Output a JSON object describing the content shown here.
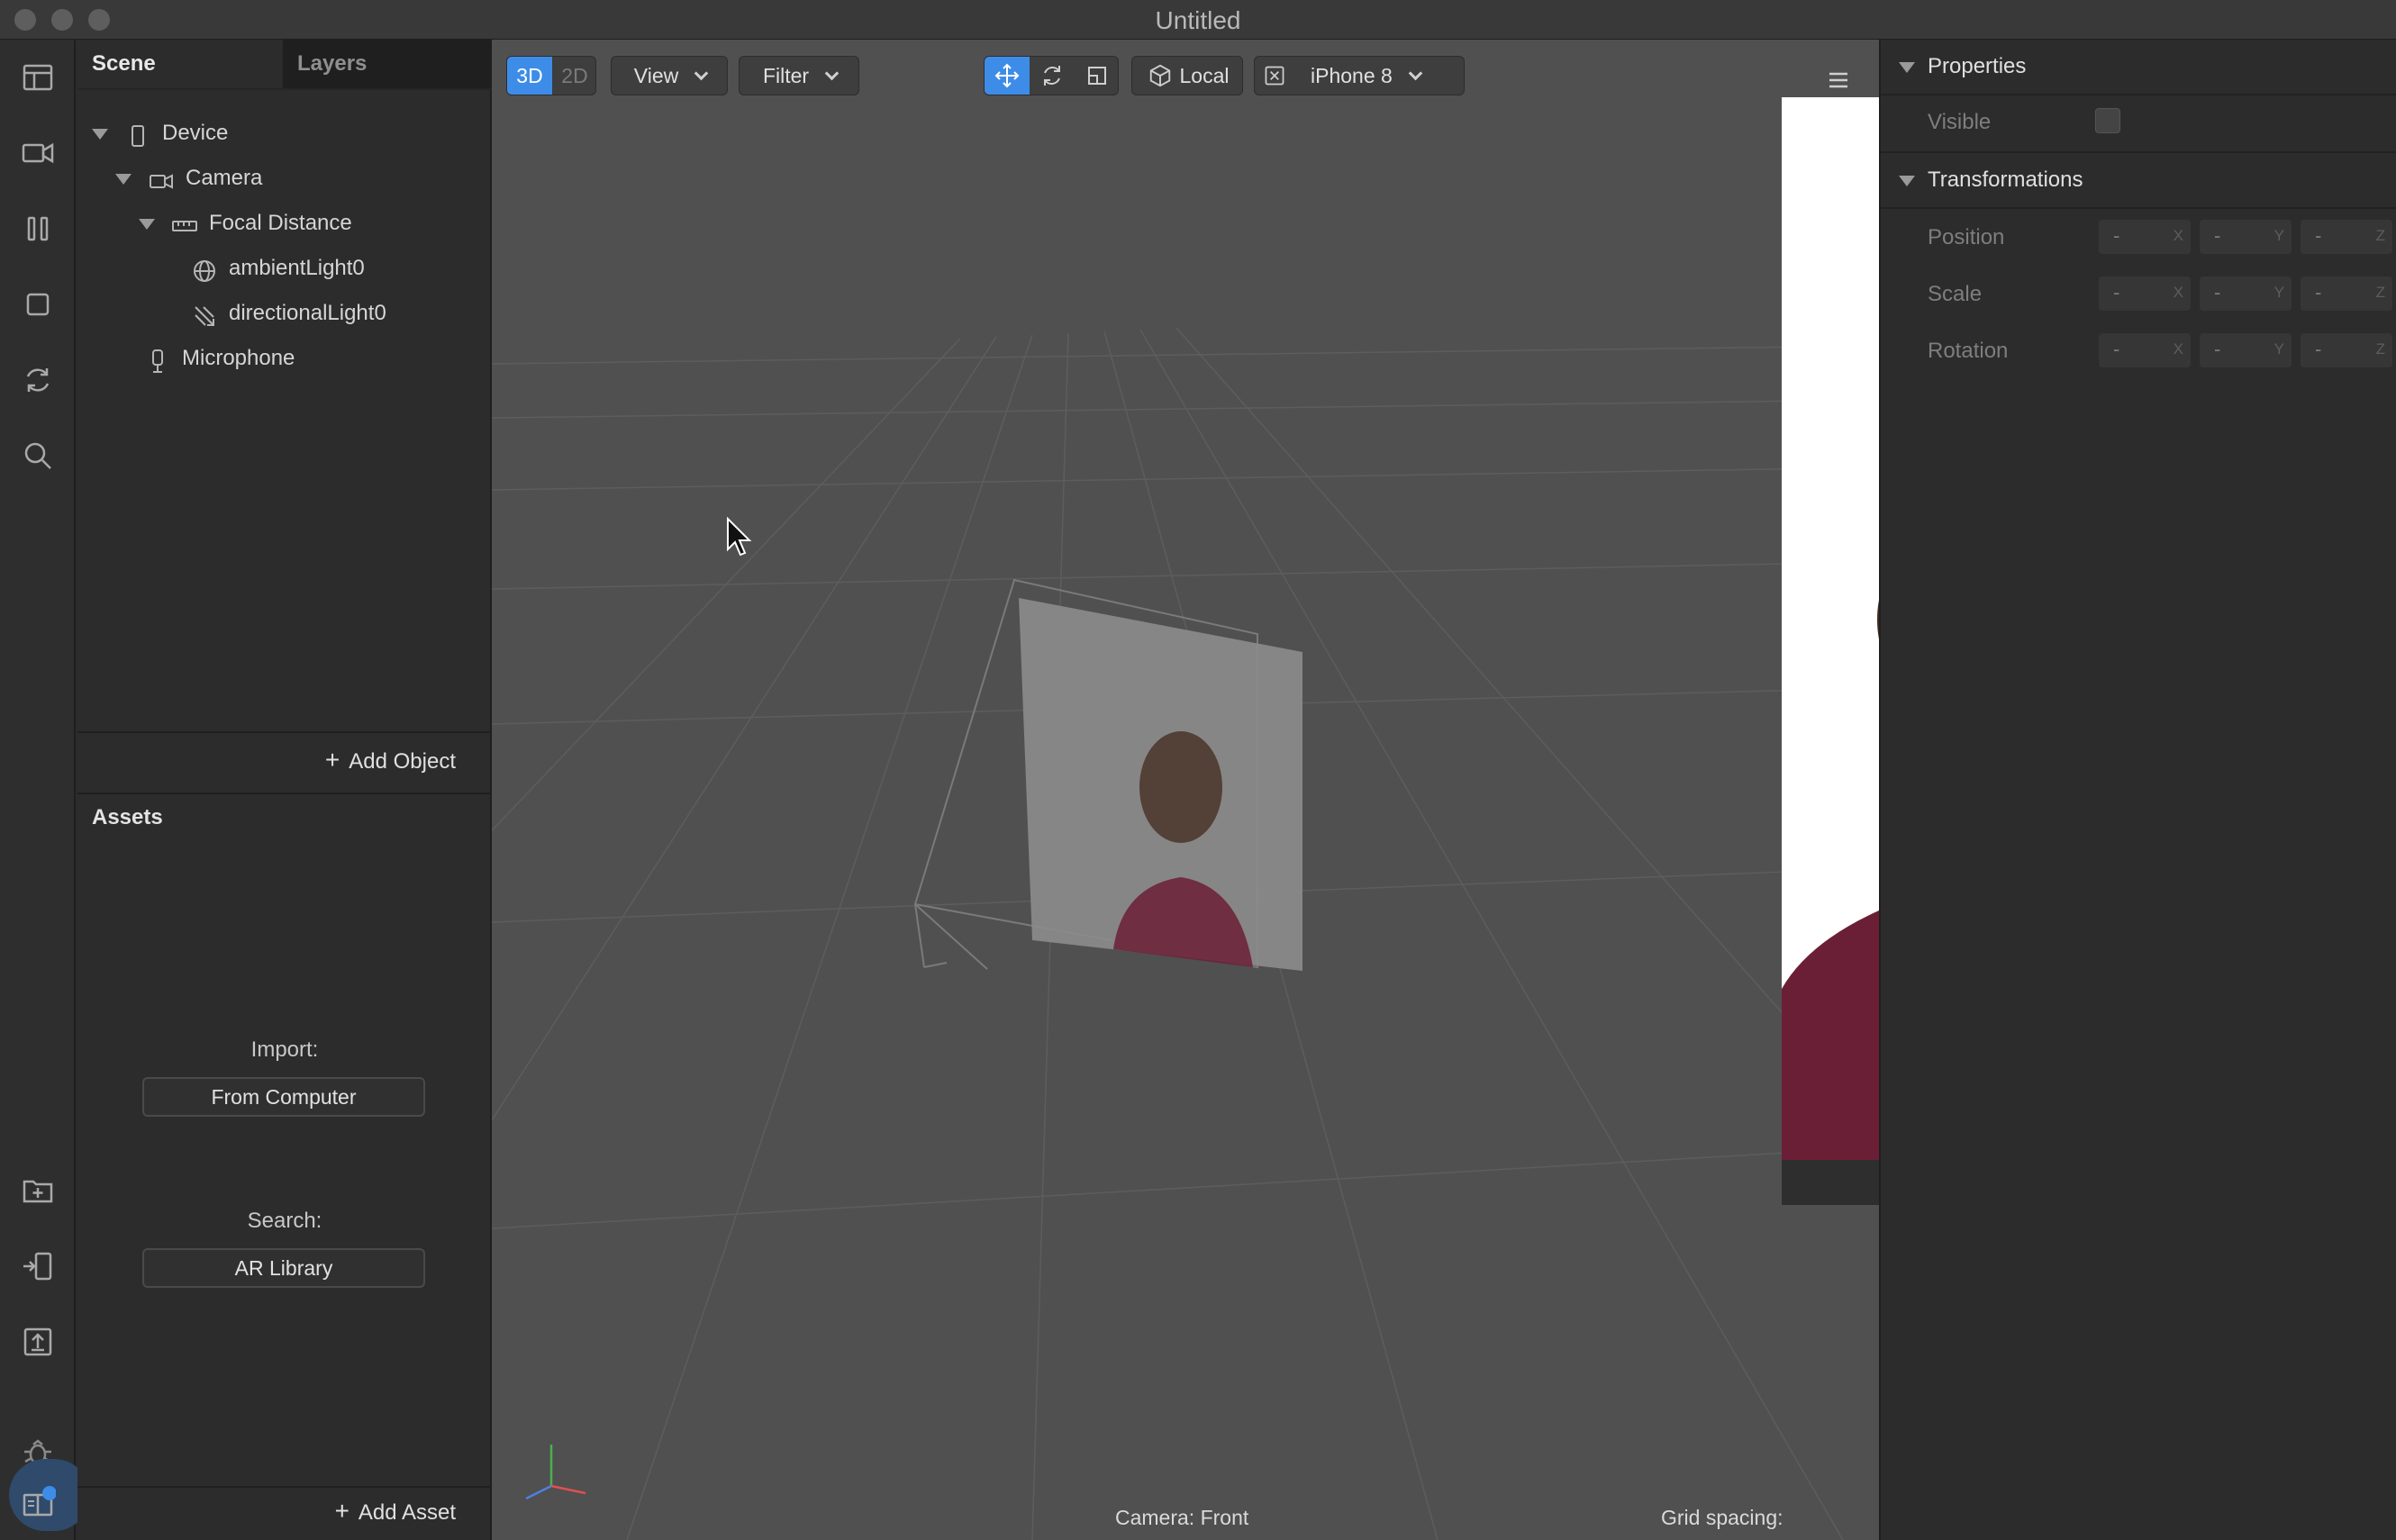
{
  "window": {
    "title": "Untitled"
  },
  "scene_panel": {
    "tabs": [
      "Scene",
      "Layers"
    ],
    "tree": [
      {
        "label": "Device",
        "icon": "device-icon"
      },
      {
        "label": "Camera",
        "icon": "camera-icon"
      },
      {
        "label": "Focal Distance",
        "icon": "ruler-icon"
      },
      {
        "label": "ambientLight0",
        "icon": "ambient-light-icon"
      },
      {
        "label": "directionalLight0",
        "icon": "directional-light-icon"
      },
      {
        "label": "Microphone",
        "icon": "microphone-icon"
      }
    ],
    "add_object": "Add Object"
  },
  "assets_panel": {
    "title": "Assets",
    "import_label": "Import:",
    "import_button": "From Computer",
    "search_label": "Search:",
    "search_button": "AR Library",
    "add_asset": "Add Asset"
  },
  "viewport": {
    "mode_3d": "3D",
    "mode_2d": "2D",
    "view_dropdown": "View",
    "filter_dropdown": "Filter",
    "space_button": "Local",
    "device_dropdown": "iPhone 8",
    "status_camera": "Camera: Front",
    "status_grid": "Grid spacing:"
  },
  "properties": {
    "section_properties": "Properties",
    "visible_label": "Visible",
    "section_transformations": "Transformations",
    "rows": [
      {
        "label": "Position",
        "values": [
          "-",
          "-",
          "-"
        ],
        "axes": [
          "X",
          "Y",
          "Z"
        ]
      },
      {
        "label": "Scale",
        "values": [
          "-",
          "-",
          "-"
        ],
        "axes": [
          "X",
          "Y",
          "Z"
        ]
      },
      {
        "label": "Rotation",
        "values": [
          "-",
          "-",
          "-"
        ],
        "axes": [
          "X",
          "Y",
          "Z"
        ]
      }
    ]
  },
  "colors": {
    "accent": "#3d8de8",
    "panel": "#2c2c2c",
    "viewport": "#505050",
    "shirt": "#6b1f36"
  }
}
